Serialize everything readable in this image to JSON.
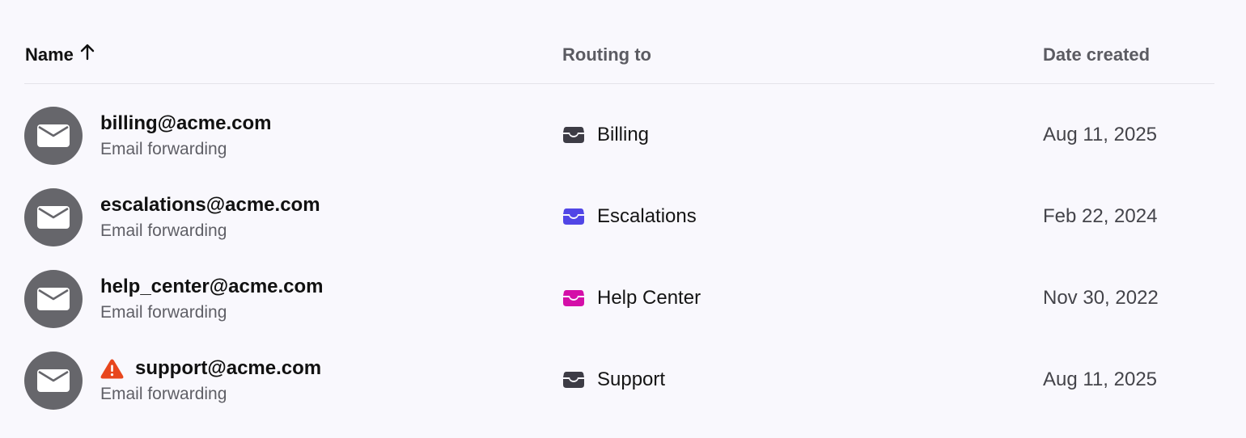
{
  "header": {
    "name_label": "Name",
    "routing_label": "Routing to",
    "date_label": "Date created",
    "sort_icon": "arrow-up-icon"
  },
  "colors": {
    "avatar_bg": "#66666b",
    "warning": "#e8461d",
    "inbox_default": "#3d3c45",
    "inbox_escalations": "#5146e6",
    "inbox_help_center": "#d40fa8"
  },
  "rows": [
    {
      "email": "billing@acme.com",
      "type": "Email forwarding",
      "routing": "Billing",
      "routing_color": "#3d3c45",
      "date": "Aug 11, 2025",
      "warning": false
    },
    {
      "email": "escalations@acme.com",
      "type": "Email forwarding",
      "routing": "Escalations",
      "routing_color": "#5146e6",
      "date": "Feb 22, 2024",
      "warning": false
    },
    {
      "email": "help_center@acme.com",
      "type": "Email forwarding",
      "routing": "Help Center",
      "routing_color": "#d40fa8",
      "date": "Nov 30, 2022",
      "warning": false
    },
    {
      "email": "support@acme.com",
      "type": "Email forwarding",
      "routing": "Support",
      "routing_color": "#3d3c45",
      "date": "Aug 11, 2025",
      "warning": true
    }
  ]
}
